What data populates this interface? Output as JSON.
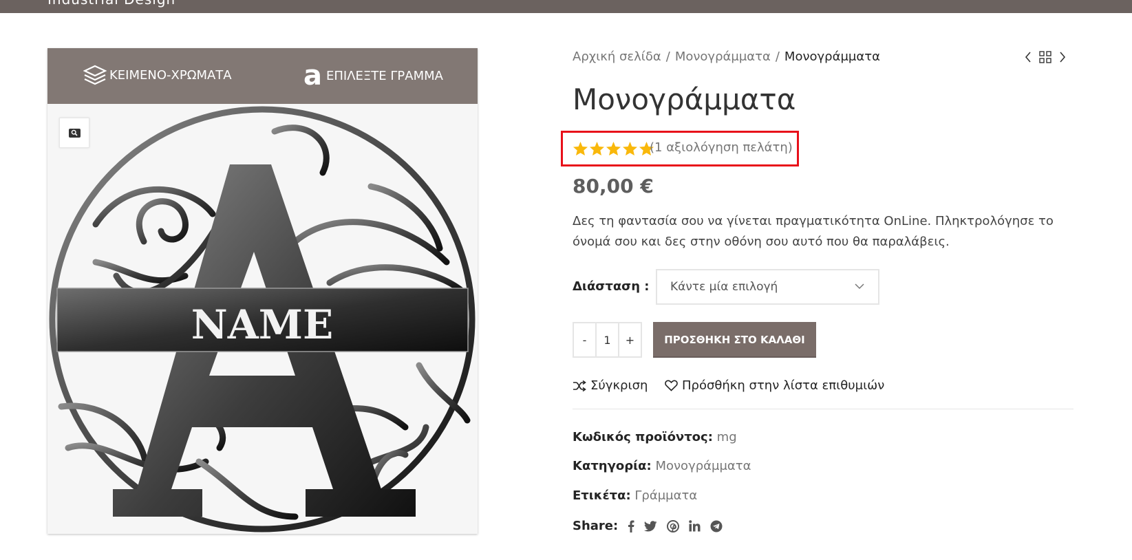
{
  "header": {
    "brand": "Industrial Design"
  },
  "gallery": {
    "tabs": [
      {
        "label": "ΚΕΙΜΕΝΟ-ΧΡΩΜΑΤΑ",
        "icon": "layers-icon"
      },
      {
        "label": "ΕΠΙΛΕΞΤΕ ΓΡΑΜΜΑ",
        "icon": "letter-a-icon"
      }
    ],
    "image_text": "NAME",
    "image_letter": "A"
  },
  "breadcrumb": {
    "items": [
      "Αρχική σελίδα",
      "Μονογράμματα"
    ],
    "current": "Μονογράμματα",
    "separator": "/"
  },
  "product": {
    "title": "Μονογράμματα",
    "rating": 5,
    "review_text": "(1 αξιολόγηση πελάτη)",
    "price": "80,00 €",
    "description": "Δες τη φαντασία σου να γίνεται πραγματικότητα OnLine. Πληκτρολόγησε το όνομά σου και δες στην οθόνη σου αυτό που θα παραλάβεις.",
    "variation_label": "Διάσταση :",
    "variation_select": "Κάντε μία επιλογή",
    "quantity": "1",
    "qty_minus": "-",
    "qty_plus": "+",
    "add_to_cart": "ΠΡΟΣΘΗΚΗ ΣΤΟ ΚΑΛΑΘΙ",
    "compare": "Σύγκριση",
    "wishlist": "Πρόσθήκη στην λίστα επιθυμιών"
  },
  "meta": {
    "sku_label": "Κωδικός προϊόντος:",
    "sku": "mg",
    "category_label": "Κατηγορία:",
    "category": "Μονογράμματα",
    "tag_label": "Ετικέτα:",
    "tag": "Γράμματα",
    "share_label": "Share:"
  },
  "colors": {
    "accent": "#7a6d69",
    "highlight": "#e8101a",
    "star": "#f9b80b",
    "topbar": "#6b625f"
  }
}
